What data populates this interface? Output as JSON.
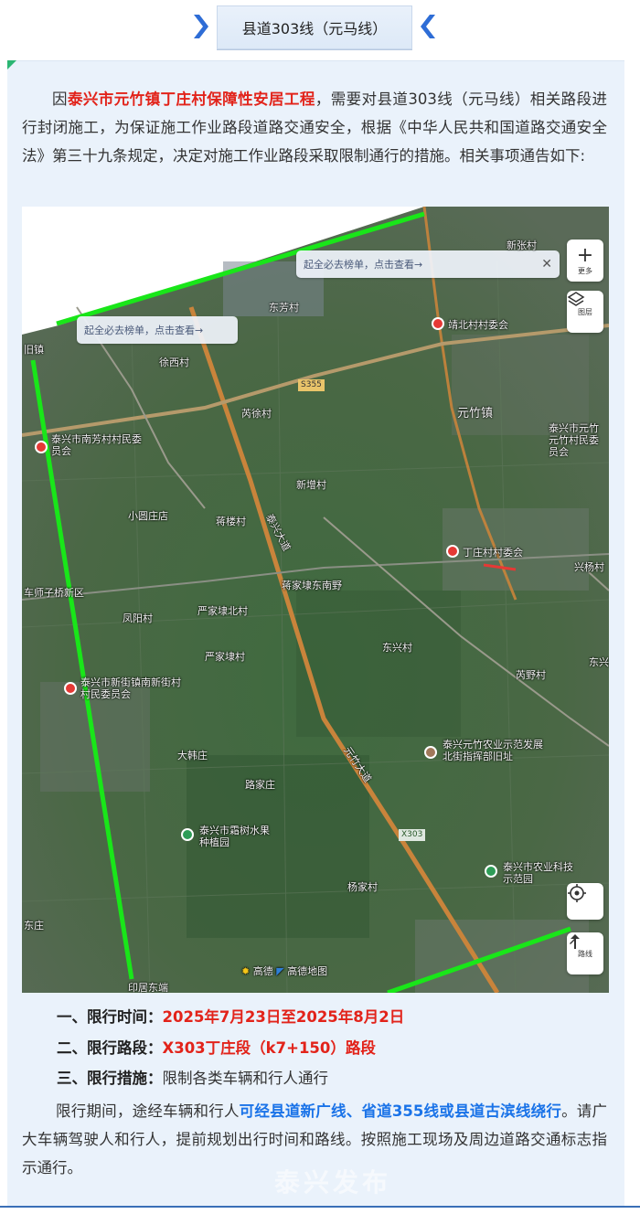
{
  "header": {
    "title": "县道303线（元马线）"
  },
  "intro": {
    "prefix": "因",
    "project": "泰兴市元竹镇丁庄村保障性安居工程",
    "body": "，需要对县道303线（元马线）相关路段进行封闭施工，为保证施工作业路段道路交通安全，根据《中华人民共和国道路交通安全法》第三十九条规定，决定对施工作业路段采取限制通行的措施。相关事项通告如下:"
  },
  "map": {
    "banner_top": "起全必去榜单，点击查看→",
    "banner_left": "起全必去榜单，点击查看→",
    "btn_more": "更多",
    "btn_layer": "图层",
    "btn_nav": "路线",
    "brand_1": "高德",
    "brand_2": "高德地图",
    "labels": {
      "l1": "东芳村",
      "l2": "靖北村村委会",
      "l3": "徐西村",
      "l4": "芮徐村",
      "l5": "元竹镇",
      "l6": "泰兴市元竹元竹村民委员会",
      "l7": "新增村",
      "l8": "泰兴市南芳村村民委员会",
      "l9": "小圆庄店",
      "l10": "蒋楼村",
      "l11": "丁庄村村委会",
      "l12": "车师子桥新区",
      "l13": "蒋家埭东南野",
      "l14": "凤阳村",
      "l15": "严家埭北村",
      "l16": "严家埭村",
      "l17": "东兴村",
      "l18": "芮野村",
      "l19": "泰兴市新街镇南新街村村民委员会",
      "l20": "泰兴元竹农业示范发展北街指挥部旧址",
      "l21": "大韩庄",
      "l22": "路家庄",
      "l23": "泰兴市霜树水果种植园",
      "l24": "泰兴市农业科技示范园",
      "l25": "杨家村",
      "l26": "印居东端",
      "l27": "东庄",
      "l28": "新张村",
      "l29": "兴杨村",
      "l30": "旧镇",
      "l31": "东兴村"
    },
    "road_shields": {
      "s1": "S355",
      "s2": "X303"
    },
    "road_names": {
      "r1": "泰兴大道",
      "r2": "元竹大道"
    }
  },
  "items": [
    {
      "label": "一、限行时间：",
      "value": "2025年7月23日至2025年8月2日"
    },
    {
      "label": "二、限行路段：",
      "value": "X303丁庄段（k7+150）路段"
    },
    {
      "label": "三、限行措施：",
      "value": "限制各类车辆和行人通行"
    }
  ],
  "closing": {
    "prefix": "限行期间，途经车辆和行人",
    "detour": "可经县道新广线、省道355线或县道古滨线绕行",
    "suffix": "。请广大车辆驾驶人和行人，提前规划出行时间和路线。按照施工现场及周边道路交通标志指示通行。"
  },
  "watermark": "泰兴发布",
  "colors": {
    "accent_blue": "#1a73e8",
    "alert_red": "#e2231a",
    "boundary_green": "#19e619",
    "card_bg": "#eaf2fb"
  }
}
